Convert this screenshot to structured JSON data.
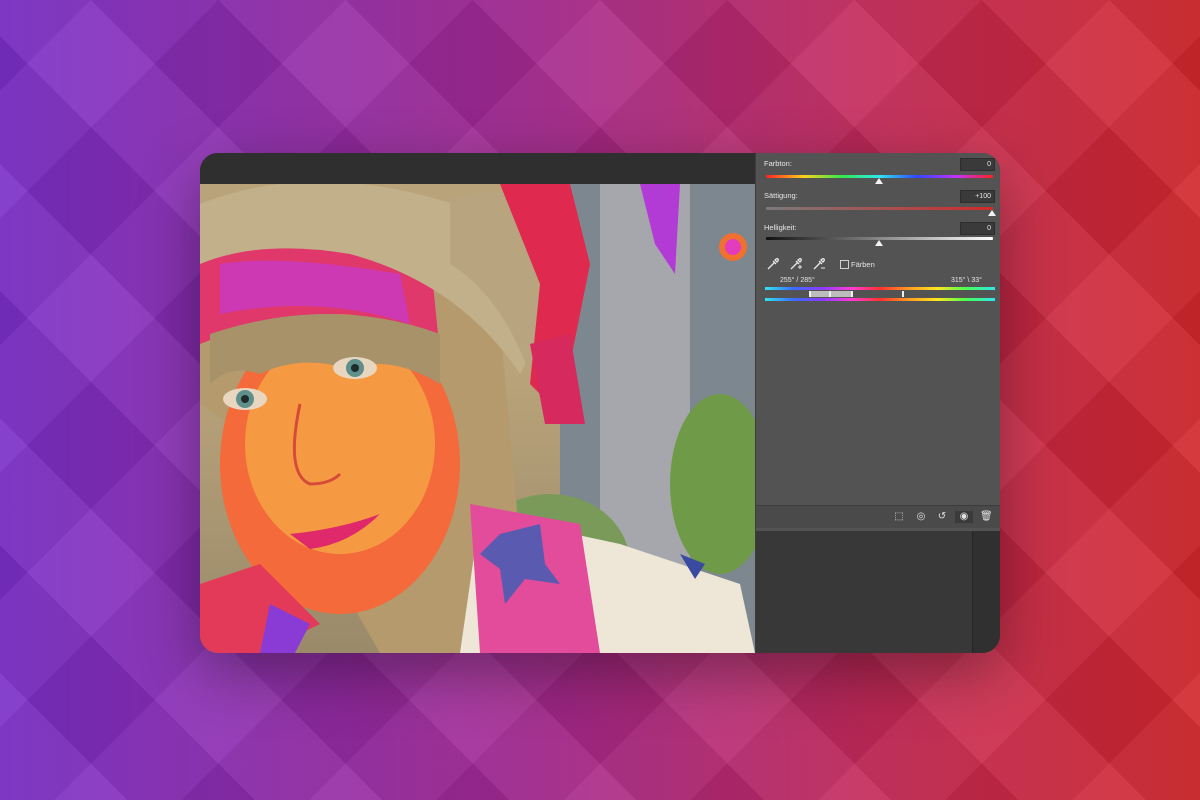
{
  "panel": {
    "hue": {
      "label": "Farbton:",
      "value": "0"
    },
    "saturation": {
      "label": "Sättigung:",
      "value": "+100"
    },
    "lightness": {
      "label": "Helligkeit:",
      "value": "0"
    },
    "colorize": {
      "label": "Färben",
      "checked": false
    },
    "range": {
      "left": "255° / 285°",
      "right": "315° \\ 33°"
    }
  },
  "footer_icons": [
    "clip-to-layer-icon",
    "visibility-preview-icon",
    "reset-icon",
    "eye-icon",
    "trash-icon"
  ]
}
